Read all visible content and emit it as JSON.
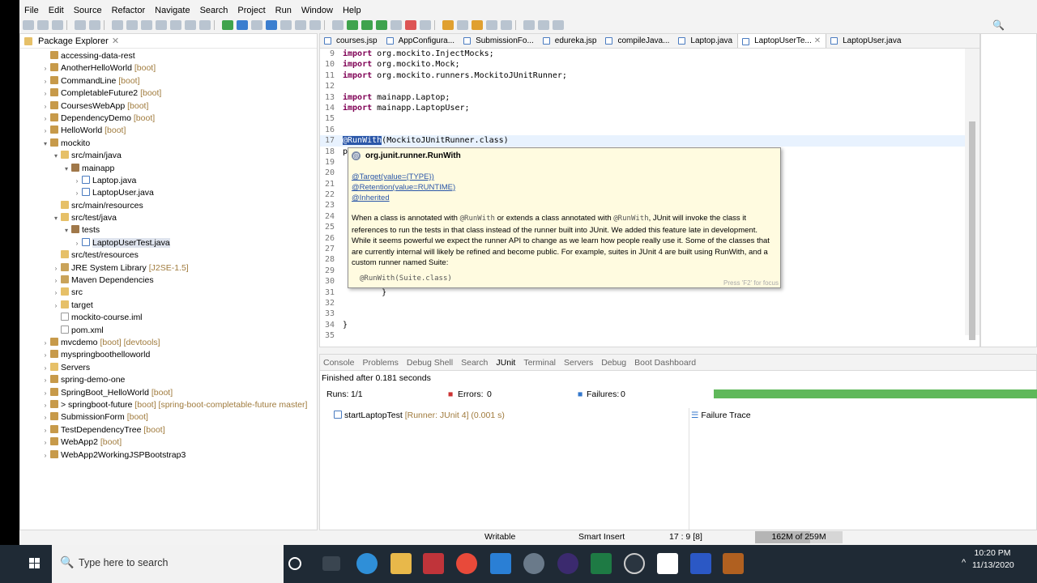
{
  "menu": [
    "File",
    "Edit",
    "Source",
    "Refactor",
    "Navigate",
    "Search",
    "Project",
    "Run",
    "Window",
    "Help"
  ],
  "package_explorer": {
    "title": "Package Explorer",
    "items": [
      {
        "depth": 0,
        "twisty": "",
        "icon": "proj",
        "label": "accessing-data-rest",
        "dec": ""
      },
      {
        "depth": 0,
        "twisty": ">",
        "icon": "proj",
        "label": "AnotherHelloWorld",
        "dec": "[boot]"
      },
      {
        "depth": 0,
        "twisty": ">",
        "icon": "proj",
        "label": "CommandLine",
        "dec": "[boot]"
      },
      {
        "depth": 0,
        "twisty": ">",
        "icon": "proj",
        "label": "CompletableFuture2",
        "dec": "[boot]"
      },
      {
        "depth": 0,
        "twisty": ">",
        "icon": "proj",
        "label": "CoursesWebApp",
        "dec": "[boot]"
      },
      {
        "depth": 0,
        "twisty": ">",
        "icon": "proj",
        "label": "DependencyDemo",
        "dec": "[boot]"
      },
      {
        "depth": 0,
        "twisty": ">",
        "icon": "proj",
        "label": "HelloWorld",
        "dec": "[boot]"
      },
      {
        "depth": 0,
        "twisty": "v",
        "icon": "proj",
        "label": "mockito",
        "dec": ""
      },
      {
        "depth": 1,
        "twisty": "v",
        "icon": "folder",
        "label": "src/main/java",
        "dec": ""
      },
      {
        "depth": 2,
        "twisty": "v",
        "icon": "pkg",
        "label": "mainapp",
        "dec": ""
      },
      {
        "depth": 3,
        "twisty": ">",
        "icon": "java",
        "label": "Laptop.java",
        "dec": ""
      },
      {
        "depth": 3,
        "twisty": ">",
        "icon": "java",
        "label": "LaptopUser.java",
        "dec": ""
      },
      {
        "depth": 1,
        "twisty": "",
        "icon": "folder",
        "label": "src/main/resources",
        "dec": ""
      },
      {
        "depth": 1,
        "twisty": "v",
        "icon": "folder",
        "label": "src/test/java",
        "dec": ""
      },
      {
        "depth": 2,
        "twisty": "v",
        "icon": "pkg",
        "label": "tests",
        "dec": ""
      },
      {
        "depth": 3,
        "twisty": ">",
        "icon": "java",
        "label": "LaptopUserTest.java",
        "dec": "",
        "selected": true
      },
      {
        "depth": 1,
        "twisty": "",
        "icon": "folder",
        "label": "src/test/resources",
        "dec": ""
      },
      {
        "depth": 1,
        "twisty": ">",
        "icon": "lib",
        "label": "JRE System Library",
        "dec": "[J2SE-1.5]"
      },
      {
        "depth": 1,
        "twisty": ">",
        "icon": "lib",
        "label": "Maven Dependencies",
        "dec": ""
      },
      {
        "depth": 1,
        "twisty": ">",
        "icon": "folder",
        "label": "src",
        "dec": ""
      },
      {
        "depth": 1,
        "twisty": ">",
        "icon": "folder",
        "label": "target",
        "dec": ""
      },
      {
        "depth": 1,
        "twisty": "",
        "icon": "file",
        "label": "mockito-course.iml",
        "dec": ""
      },
      {
        "depth": 1,
        "twisty": "",
        "icon": "file",
        "label": "pom.xml",
        "dec": ""
      },
      {
        "depth": 0,
        "twisty": ">",
        "icon": "proj",
        "label": "mvcdemo",
        "dec": "[boot] [devtools]"
      },
      {
        "depth": 0,
        "twisty": ">",
        "icon": "proj",
        "label": "myspringboothelloworld",
        "dec": ""
      },
      {
        "depth": 0,
        "twisty": ">",
        "icon": "folder",
        "label": "Servers",
        "dec": ""
      },
      {
        "depth": 0,
        "twisty": ">",
        "icon": "proj",
        "label": "spring-demo-one",
        "dec": ""
      },
      {
        "depth": 0,
        "twisty": ">",
        "icon": "proj",
        "label": "SpringBoot_HelloWorld",
        "dec": "[boot]"
      },
      {
        "depth": 0,
        "twisty": ">",
        "icon": "proj",
        "label": "> springboot-future",
        "dec": "[boot] [spring-boot-completable-future master]"
      },
      {
        "depth": 0,
        "twisty": ">",
        "icon": "proj",
        "label": "SubmissionForm",
        "dec": "[boot]"
      },
      {
        "depth": 0,
        "twisty": ">",
        "icon": "proj",
        "label": "TestDependencyTree",
        "dec": "[boot]"
      },
      {
        "depth": 0,
        "twisty": ">",
        "icon": "proj",
        "label": "WebApp2",
        "dec": "[boot]"
      },
      {
        "depth": 0,
        "twisty": ">",
        "icon": "proj",
        "label": "WebApp2WorkingJSPBootstrap3",
        "dec": ""
      }
    ]
  },
  "editor": {
    "tabs": [
      {
        "label": "courses.jsp",
        "active": false
      },
      {
        "label": "AppConfigura...",
        "active": false
      },
      {
        "label": "SubmissionFo...",
        "active": false
      },
      {
        "label": "edureka.jsp",
        "active": false
      },
      {
        "label": "compileJava...",
        "active": false
      },
      {
        "label": "Laptop.java",
        "active": false
      },
      {
        "label": "LaptopUserTe...",
        "active": true
      },
      {
        "label": "LaptopUser.java",
        "active": false
      }
    ],
    "lines": [
      {
        "n": "9",
        "code": "import org.mockito.InjectMocks;"
      },
      {
        "n": "10",
        "code": "import org.mockito.Mock;"
      },
      {
        "n": "11",
        "code": "import org.mockito.runners.MockitoJUnitRunner;"
      },
      {
        "n": "12",
        "code": ""
      },
      {
        "n": "13",
        "code": "import mainapp.Laptop;"
      },
      {
        "n": "14",
        "code": "import mainapp.LaptopUser;"
      },
      {
        "n": "15",
        "code": ""
      },
      {
        "n": "16",
        "code": ""
      },
      {
        "n": "17",
        "code": "@RunWith(MockitoJUnitRunner.class)"
      },
      {
        "n": "18",
        "code": "p"
      },
      {
        "n": "19",
        "code": ""
      },
      {
        "n": "20",
        "code": ""
      },
      {
        "n": "21",
        "code": ""
      },
      {
        "n": "22",
        "code": ""
      },
      {
        "n": "23",
        "code": ""
      },
      {
        "n": "24",
        "code": ""
      },
      {
        "n": "25",
        "code": ""
      },
      {
        "n": "26",
        "code": ""
      },
      {
        "n": "27",
        "code": ""
      },
      {
        "n": "28",
        "code": ""
      },
      {
        "n": "29",
        "code": ""
      },
      {
        "n": "30",
        "code": ""
      },
      {
        "n": "31",
        "code": "        }"
      },
      {
        "n": "32",
        "code": ""
      },
      {
        "n": "33",
        "code": ""
      },
      {
        "n": "34",
        "code": "}"
      },
      {
        "n": "35",
        "code": ""
      }
    ]
  },
  "hover": {
    "title": "org.junit.runner.RunWith",
    "target": "@Target(value={TYPE})",
    "retention": "@Retention(value=RUNTIME)",
    "inherited": "@Inherited",
    "description_1": "When a class is annotated with",
    "code_1": "@RunWith",
    "description_2": "or extends a class annotated with",
    "code_2": "@RunWith",
    "description_3": ", JUnit will invoke the class it references to run the tests in that class instead of the runner built into JUnit. We added this feature late in development. While it seems powerful we expect the runner API to change as we learn how people really use it. Some of the classes that are currently internal will likely be refined and become public. For example, suites in JUnit 4 are built using RunWith, and a custom runner named Suite:",
    "code_sample": "@RunWith(Suite.class)",
    "hint": "Press 'F2' for focus"
  },
  "bottom": {
    "tabs": [
      {
        "label": "Console",
        "active": false
      },
      {
        "label": "Problems",
        "active": false
      },
      {
        "label": "Debug Shell",
        "active": false
      },
      {
        "label": "Search",
        "active": false
      },
      {
        "label": "JUnit",
        "active": true
      },
      {
        "label": "Terminal",
        "active": false
      },
      {
        "label": "Servers",
        "active": false
      },
      {
        "label": "Debug",
        "active": false
      },
      {
        "label": "Boot Dashboard",
        "active": false
      }
    ],
    "finished": "Finished after 0.181 seconds",
    "runs_label": "Runs:",
    "runs_value": "1/1",
    "errors_label": "Errors:",
    "errors_value": "0",
    "failures_label": "Failures:",
    "failures_value": "0",
    "progress": 1.0,
    "test": "startLaptopTest",
    "test_runner": "[Runner: JUnit 4] (0.001 s)",
    "failure_trace": "Failure Trace"
  },
  "status": {
    "writable": "Writable",
    "insert": "Smart Insert",
    "position": "17 : 9 [8]",
    "heap": "162M of 259M",
    "heap_fraction": 0.625
  },
  "taskbar": {
    "search_placeholder": "Type here to search",
    "time": "10:20 PM",
    "date": "11/13/2020"
  },
  "colors": {
    "junit_green": "#5fb85a",
    "selection": "#2a56a8",
    "hover_bg": "#fffbe0"
  }
}
